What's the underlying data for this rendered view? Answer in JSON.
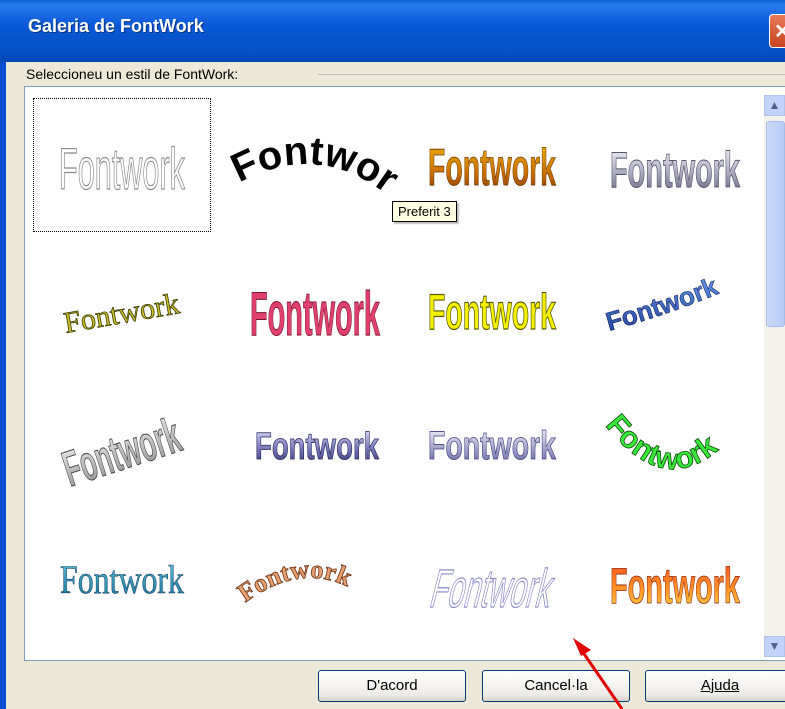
{
  "window": {
    "title": "Galeria de FontWork",
    "close_glyph": "✕"
  },
  "group": {
    "label": "Seleccioneu un estil de FontWork:"
  },
  "gallery": {
    "items": [
      {
        "text": "Fontwork",
        "tooltip": ""
      },
      {
        "text": "Fontwork",
        "tooltip": ""
      },
      {
        "text": "Fontwork",
        "tooltip": "Preferit 3"
      },
      {
        "text": "Fontwork",
        "tooltip": ""
      },
      {
        "text": "Fontwork",
        "tooltip": ""
      },
      {
        "text": "Fontwork",
        "tooltip": ""
      },
      {
        "text": "Fontwork",
        "tooltip": ""
      },
      {
        "text": "Fontwork",
        "tooltip": ""
      },
      {
        "text": "Fontwork",
        "tooltip": ""
      },
      {
        "text": "Fontwork",
        "tooltip": ""
      },
      {
        "text": "Fontwork",
        "tooltip": ""
      },
      {
        "text": "Fontwork",
        "tooltip": ""
      },
      {
        "text": "Fontwork",
        "tooltip": ""
      },
      {
        "text": "Fontwork",
        "tooltip": ""
      },
      {
        "text": "Fontwork",
        "tooltip": ""
      },
      {
        "text": "Fontwork",
        "tooltip": ""
      }
    ],
    "selected_index": 0,
    "hovered_tooltip": "Preferit 3"
  },
  "scrollbar": {
    "up_glyph": "▲",
    "down_glyph": "▼"
  },
  "buttons": {
    "ok": "D'acord",
    "cancel": "Cancel·la",
    "help": "Ajuda"
  },
  "colors": {
    "titlebar": "#0a58d6",
    "annotation_arrow": "#e00000"
  }
}
